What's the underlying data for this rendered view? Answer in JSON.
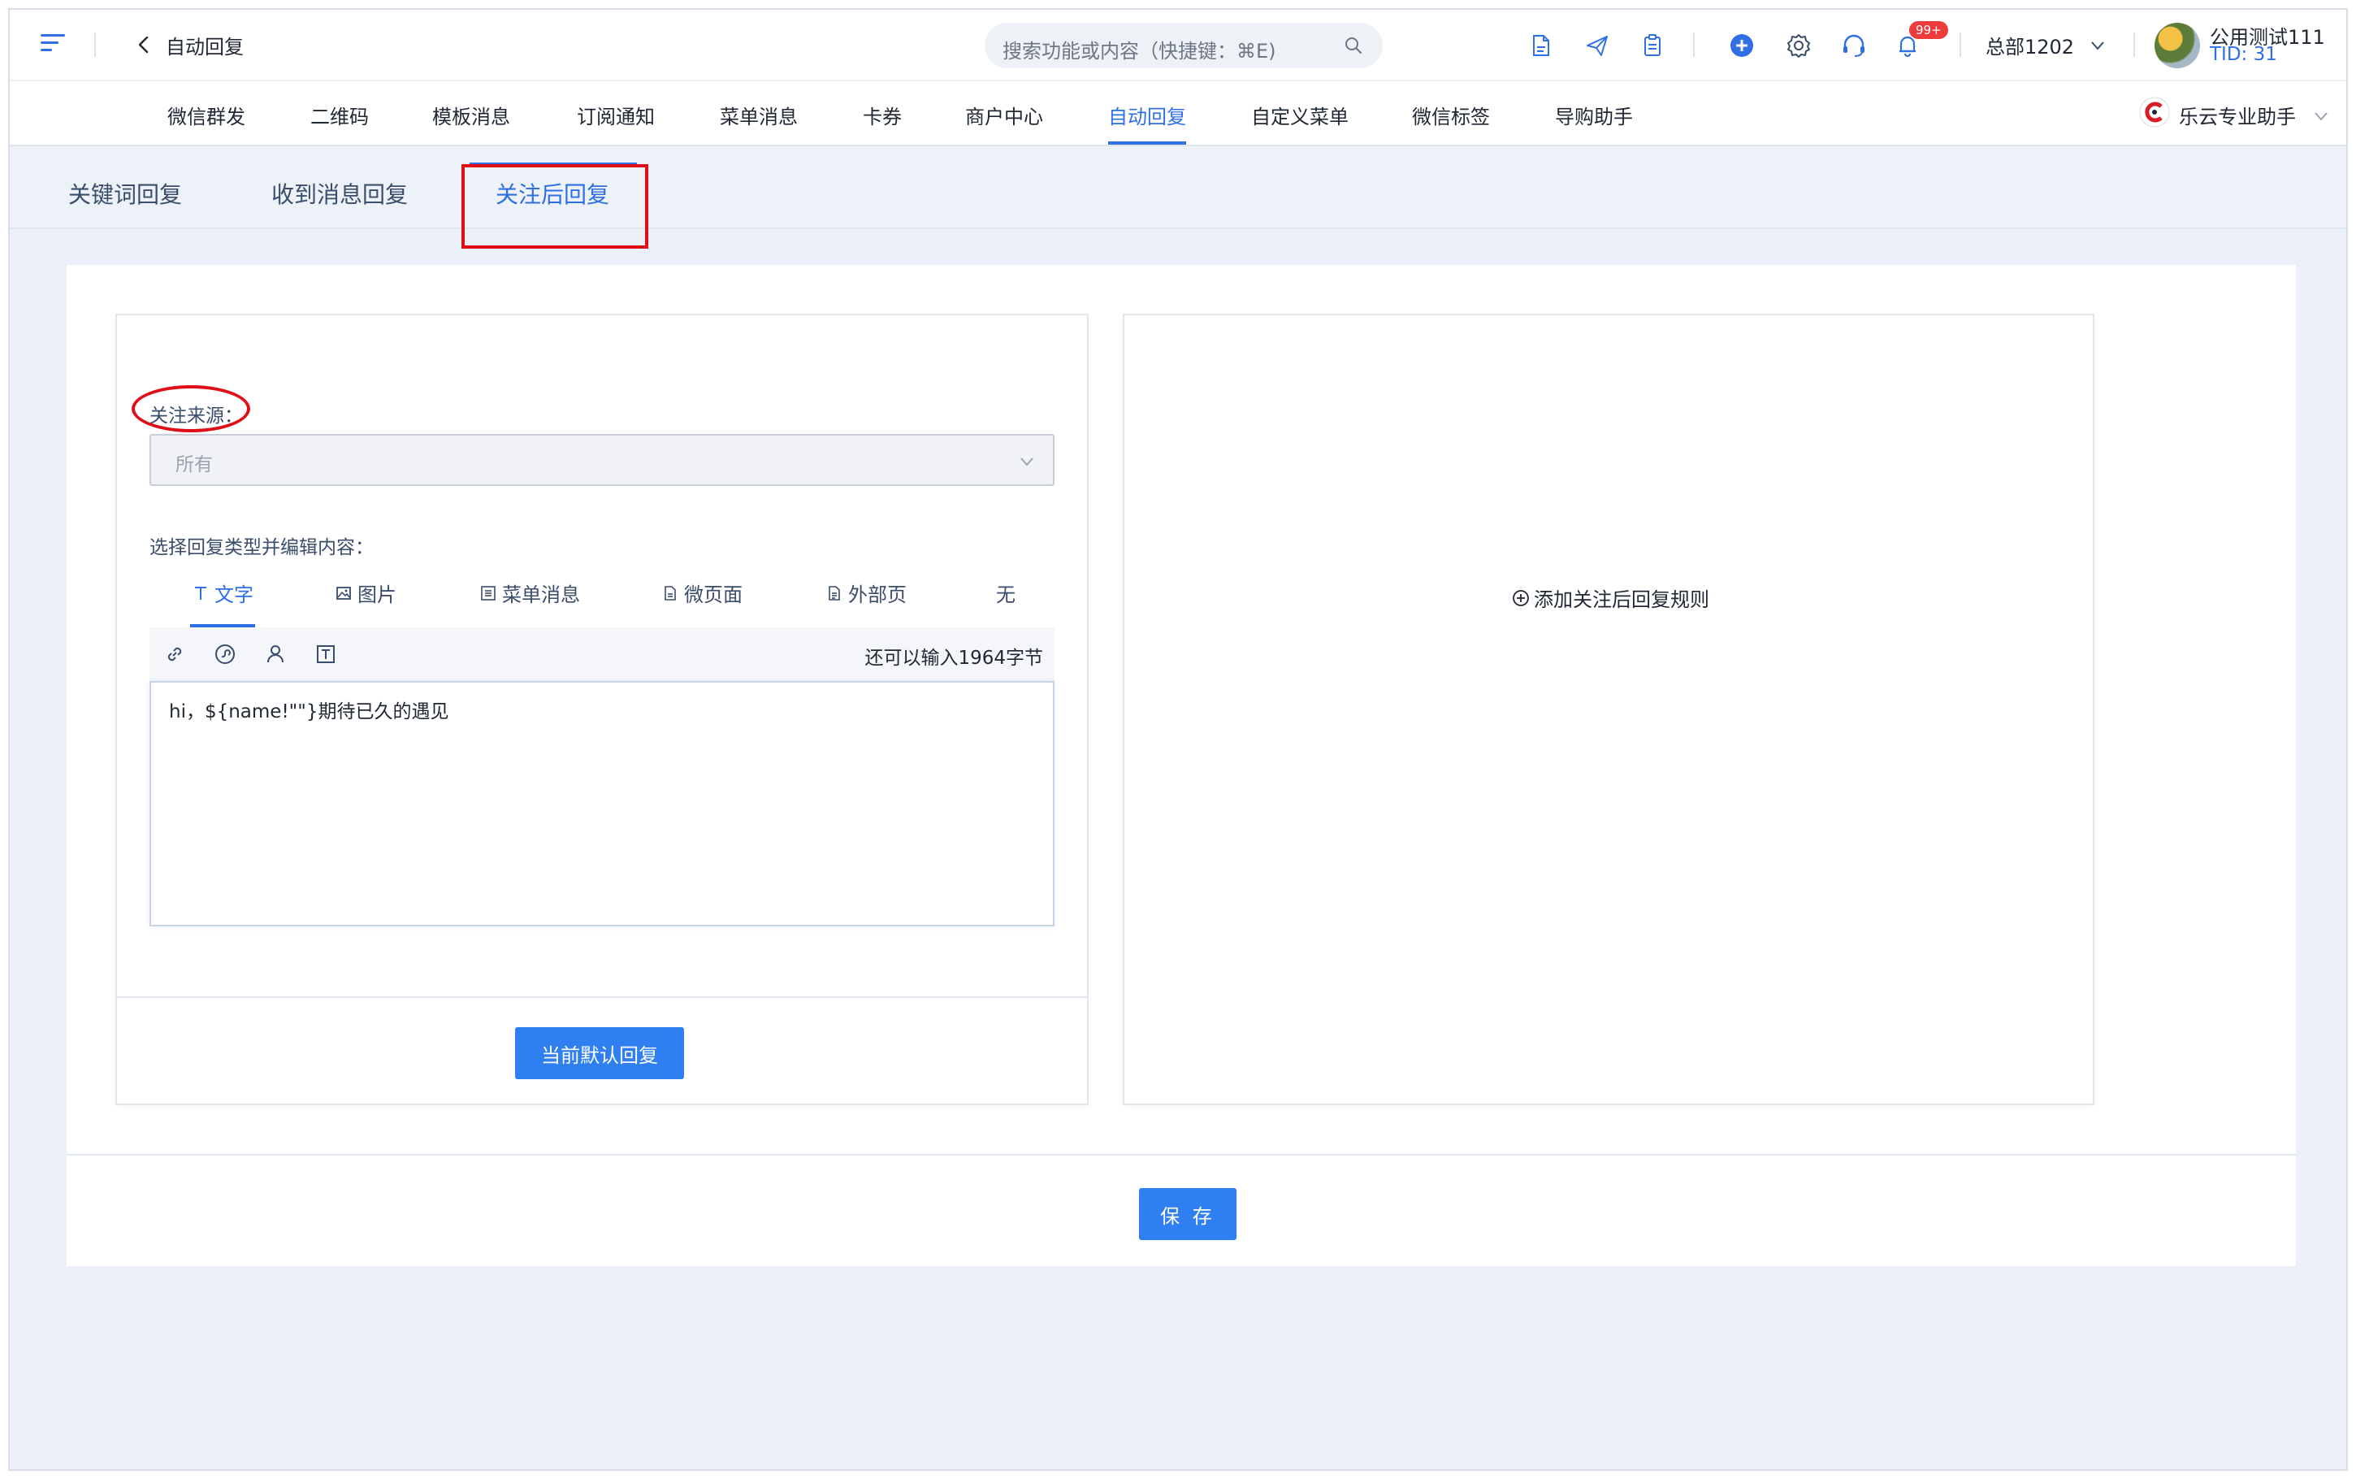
{
  "topbar": {
    "title": "自动回复",
    "search_placeholder": "搜索功能或内容（快捷键：⌘E)",
    "notification_badge": "99+",
    "org_name": "总部1202",
    "user_name": "公用测试111",
    "user_tid": "TID: 31",
    "icons": [
      "document-icon",
      "send-icon",
      "clipboard-icon",
      "add-circle-icon",
      "gear-icon",
      "headset-icon",
      "bell-icon"
    ]
  },
  "nav": {
    "items": [
      "微信群发",
      "二维码",
      "模板消息",
      "订阅通知",
      "菜单消息",
      "卡券",
      "商户中心",
      "自动回复",
      "自定义菜单",
      "微信标签",
      "导购助手"
    ],
    "active": "自动回复",
    "assistant": "乐云专业助手"
  },
  "tabs": {
    "items": [
      "关键词回复",
      "收到消息回复",
      "关注后回复"
    ],
    "active": "关注后回复"
  },
  "form": {
    "source_label": "关注来源：",
    "source_value": "所有",
    "type_label": "选择回复类型并编辑内容：",
    "types": [
      "文字",
      "图片",
      "菜单消息",
      "微页面",
      "外部页",
      "无"
    ],
    "active_type": "文字",
    "remaining": "还可以输入1964字节",
    "content": "hi，${name!\"\"}期待已久的遇见",
    "default_button": "当前默认回复"
  },
  "right": {
    "add_rule": "添加关注后回复规则"
  },
  "footer": {
    "save": "保 存"
  },
  "colors": {
    "accent": "#2f6fe4",
    "button": "#2f7ff0",
    "highlight": "#e00f17",
    "badge": "#ee3b3b"
  }
}
